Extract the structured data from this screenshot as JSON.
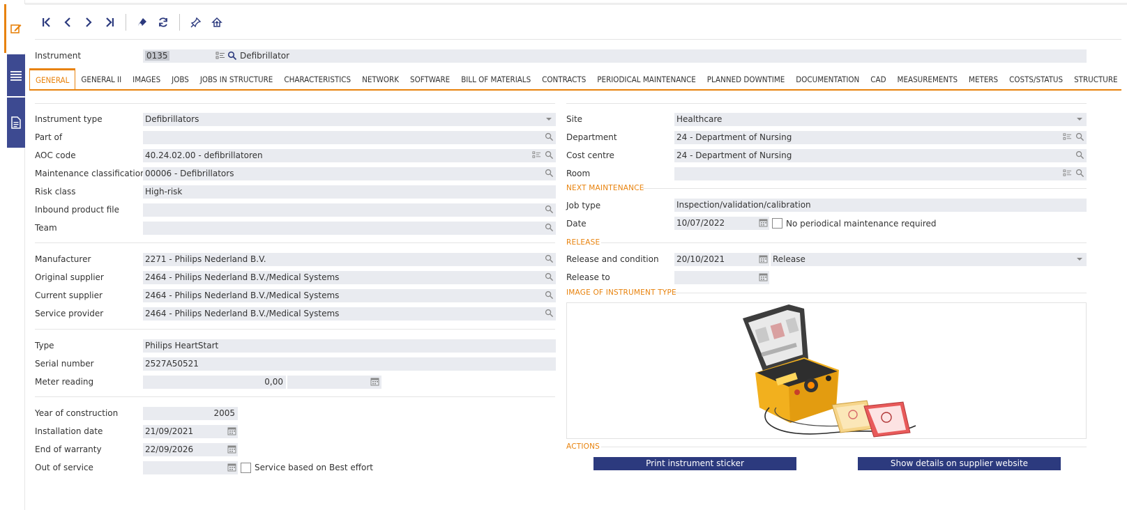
{
  "header": {
    "instrument_label": "Instrument",
    "instrument_code": "0135",
    "instrument_name": "Defibrillator"
  },
  "tabs": [
    "GENERAL",
    "GENERAL II",
    "IMAGES",
    "JOBS",
    "JOBS IN STRUCTURE",
    "CHARACTERISTICS",
    "NETWORK",
    "SOFTWARE",
    "BILL OF MATERIALS",
    "CONTRACTS",
    "PERIODICAL MAINTENANCE",
    "PLANNED DOWNTIME",
    "DOCUMENTATION",
    "CAD",
    "MEASUREMENTS",
    "METERS",
    "COSTS/STATUS",
    "STRUCTURE"
  ],
  "left": {
    "instrument_type": {
      "label": "Instrument type",
      "value": "Defibrillators"
    },
    "part_of": {
      "label": "Part of",
      "value": ""
    },
    "aoc_code": {
      "label": "AOC code",
      "value": "40.24.02.00 - defibrillatoren"
    },
    "maintenance_classification": {
      "label": "Maintenance classification",
      "value": "00006 - Defibrillators"
    },
    "risk_class": {
      "label": "Risk class",
      "value": "High-risk"
    },
    "inbound_product_file": {
      "label": "Inbound product file",
      "value": ""
    },
    "team": {
      "label": "Team",
      "value": ""
    },
    "manufacturer": {
      "label": "Manufacturer",
      "value": "2271 - Philips Nederland B.V."
    },
    "original_supplier": {
      "label": "Original supplier",
      "value": "2464 - Philips Nederland B.V./Medical Systems"
    },
    "current_supplier": {
      "label": "Current supplier",
      "value": "2464 - Philips Nederland B.V./Medical Systems"
    },
    "service_provider": {
      "label": "Service provider",
      "value": "2464 - Philips Nederland B.V./Medical Systems"
    },
    "type": {
      "label": "Type",
      "value": "Philips HeartStart"
    },
    "serial_number": {
      "label": "Serial number",
      "value": "2527A50521"
    },
    "meter_reading": {
      "label": "Meter reading",
      "value": "0,00",
      "date": ""
    },
    "year_of_construction": {
      "label": "Year of construction",
      "value": "2005"
    },
    "installation_date": {
      "label": "Installation date",
      "value": "21/09/2021"
    },
    "end_of_warranty": {
      "label": "End of warranty",
      "value": "22/09/2026"
    },
    "out_of_service": {
      "label": "Out of service",
      "value": "",
      "checkbox_label": "Service based on Best effort"
    }
  },
  "right": {
    "site": {
      "label": "Site",
      "value": "Healthcare"
    },
    "department": {
      "label": "Department",
      "value": "24 - Department of Nursing"
    },
    "cost_centre": {
      "label": "Cost centre",
      "value": "24 - Department of Nursing"
    },
    "room": {
      "label": "Room",
      "value": ""
    },
    "next_maintenance_title": "NEXT MAINTENANCE",
    "job_type": {
      "label": "Job type",
      "value": "Inspection/validation/calibration"
    },
    "date": {
      "label": "Date",
      "value": "10/07/2022",
      "checkbox_label": "No periodical maintenance required"
    },
    "release_title": "RELEASE",
    "release_condition": {
      "label": "Release and condition",
      "date": "20/10/2021",
      "value": "Release"
    },
    "release_to": {
      "label": "Release to",
      "value": ""
    },
    "image_title": "IMAGE OF INSTRUMENT TYPE",
    "actions_title": "ACTIONS",
    "print_button": "Print instrument sticker",
    "supplier_button": "Show details on supplier website"
  },
  "colors": {
    "accent": "#e8820c",
    "rail": "#3d4a91",
    "button": "#2c3a7e",
    "field": "#e9ebf0"
  }
}
